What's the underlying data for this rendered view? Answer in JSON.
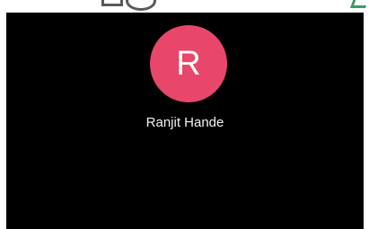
{
  "status_bar": {
    "icons": [
      "status-icon",
      "status-icon",
      "status-icon"
    ]
  },
  "call": {
    "avatar_initial": "R",
    "avatar_color": "#e8466a",
    "caller_name": "Ranjit Hande"
  },
  "colors": {
    "background": "#000000",
    "avatar": "#e8466a",
    "text": "#f2f2f2"
  }
}
